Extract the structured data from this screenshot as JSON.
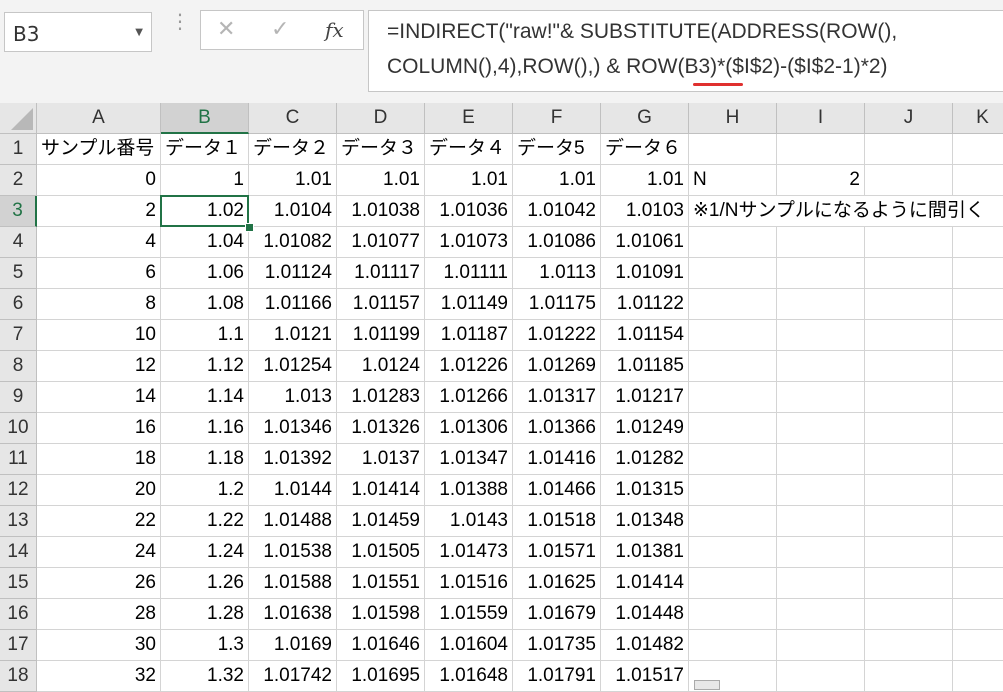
{
  "name_box": {
    "value": "B3"
  },
  "formula_bar": {
    "line1": "=INDIRECT(\"raw!\"& SUBSTITUTE(ADDRESS(ROW(),",
    "line2": "COLUMN(),4),ROW(),) & ROW(B3)*($I$2)-($I$2-1)*2)",
    "cancel_icon": "close-icon",
    "enter_icon": "check-icon",
    "fx_label": "fx"
  },
  "sheet": {
    "active_cell": "B3",
    "accent_color": "#217346",
    "column_letters": [
      "A",
      "B",
      "C",
      "D",
      "E",
      "F",
      "G",
      "H",
      "I",
      "J",
      "K"
    ],
    "header_row": [
      "サンプル番号",
      "データ１",
      "データ２",
      "データ３",
      "データ４",
      "データ5",
      "データ６"
    ],
    "rows": [
      {
        "num": "2",
        "cells": [
          "0",
          "1",
          "1.01",
          "1.01",
          "1.01",
          "1.01",
          "1.01"
        ]
      },
      {
        "num": "3",
        "cells": [
          "2",
          "1.02",
          "1.0104",
          "1.01038",
          "1.01036",
          "1.01042",
          "1.0103"
        ]
      },
      {
        "num": "4",
        "cells": [
          "4",
          "1.04",
          "1.01082",
          "1.01077",
          "1.01073",
          "1.01086",
          "1.01061"
        ]
      },
      {
        "num": "5",
        "cells": [
          "6",
          "1.06",
          "1.01124",
          "1.01117",
          "1.01111",
          "1.0113",
          "1.01091"
        ]
      },
      {
        "num": "6",
        "cells": [
          "8",
          "1.08",
          "1.01166",
          "1.01157",
          "1.01149",
          "1.01175",
          "1.01122"
        ]
      },
      {
        "num": "7",
        "cells": [
          "10",
          "1.1",
          "1.0121",
          "1.01199",
          "1.01187",
          "1.01222",
          "1.01154"
        ]
      },
      {
        "num": "8",
        "cells": [
          "12",
          "1.12",
          "1.01254",
          "1.0124",
          "1.01226",
          "1.01269",
          "1.01185"
        ]
      },
      {
        "num": "9",
        "cells": [
          "14",
          "1.14",
          "1.013",
          "1.01283",
          "1.01266",
          "1.01317",
          "1.01217"
        ]
      },
      {
        "num": "10",
        "cells": [
          "16",
          "1.16",
          "1.01346",
          "1.01326",
          "1.01306",
          "1.01366",
          "1.01249"
        ]
      },
      {
        "num": "11",
        "cells": [
          "18",
          "1.18",
          "1.01392",
          "1.0137",
          "1.01347",
          "1.01416",
          "1.01282"
        ]
      },
      {
        "num": "12",
        "cells": [
          "20",
          "1.2",
          "1.0144",
          "1.01414",
          "1.01388",
          "1.01466",
          "1.01315"
        ]
      },
      {
        "num": "13",
        "cells": [
          "22",
          "1.22",
          "1.01488",
          "1.01459",
          "1.0143",
          "1.01518",
          "1.01348"
        ]
      },
      {
        "num": "14",
        "cells": [
          "24",
          "1.24",
          "1.01538",
          "1.01505",
          "1.01473",
          "1.01571",
          "1.01381"
        ]
      },
      {
        "num": "15",
        "cells": [
          "26",
          "1.26",
          "1.01588",
          "1.01551",
          "1.01516",
          "1.01625",
          "1.01414"
        ]
      },
      {
        "num": "16",
        "cells": [
          "28",
          "1.28",
          "1.01638",
          "1.01598",
          "1.01559",
          "1.01679",
          "1.01448"
        ]
      },
      {
        "num": "17",
        "cells": [
          "30",
          "1.3",
          "1.0169",
          "1.01646",
          "1.01604",
          "1.01735",
          "1.01482"
        ]
      },
      {
        "num": "18",
        "cells": [
          "32",
          "1.32",
          "1.01742",
          "1.01695",
          "1.01648",
          "1.01791",
          "1.01517"
        ]
      }
    ],
    "row1_num": "1",
    "h2": "N",
    "i2": "2",
    "h3_note": "※1/Nサンプルになるように間引く"
  }
}
